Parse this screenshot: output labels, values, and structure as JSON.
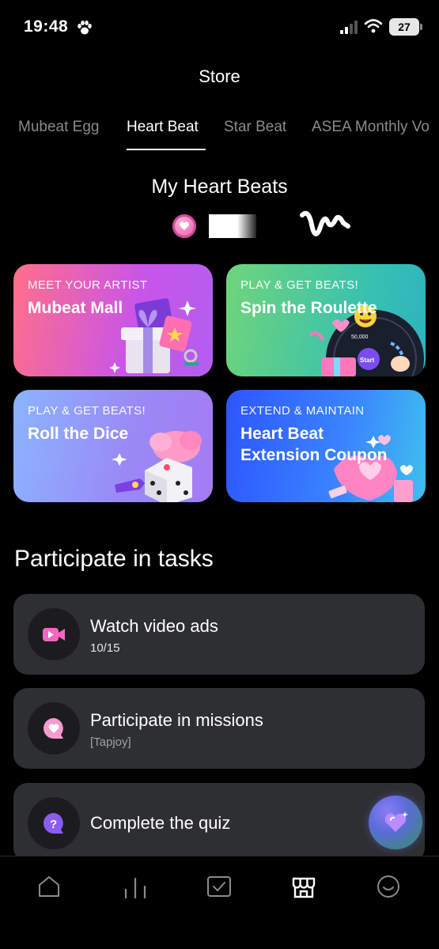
{
  "status_bar": {
    "time": "19:48",
    "battery": "27",
    "icons": [
      "paw-icon",
      "cellular-signal-icon",
      "wifi-icon",
      "battery-icon"
    ]
  },
  "header": {
    "title": "Store"
  },
  "tabs": [
    {
      "label": "Mubeat Egg",
      "active": false
    },
    {
      "label": "Heart Beat",
      "active": true
    },
    {
      "label": "Star Beat",
      "active": false
    },
    {
      "label": "ASEA Monthly Vo",
      "active": false
    }
  ],
  "my_heart_beats": {
    "title": "My Heart Beats"
  },
  "cards": [
    {
      "kicker": "MEET YOUR ARTIST",
      "title": "Mubeat Mall"
    },
    {
      "kicker": "PLAY & GET BEATS!",
      "title": "Spin the Roulette",
      "art_text_1": "50,000",
      "art_text_2": "Start"
    },
    {
      "kicker": "PLAY & GET BEATS!",
      "title": "Roll the Dice"
    },
    {
      "kicker": "EXTEND & MAINTAIN",
      "title_line1": "Heart Beat",
      "title_line2": "Extension Coupon"
    }
  ],
  "tasks": {
    "title": "Participate in tasks",
    "items": [
      {
        "name": "Watch video ads",
        "sub": "10/15",
        "icon": "video-camera-icon"
      },
      {
        "name": "Participate in missions",
        "sub": "[Tapjoy]",
        "icon": "heart-chat-icon"
      },
      {
        "name": "Complete the quiz",
        "icon": "question-chat-icon"
      }
    ]
  },
  "bottom_nav": {
    "items": [
      "home-icon",
      "charts-icon",
      "vote-check-icon",
      "store-icon",
      "profile-icon"
    ],
    "active": "store-icon"
  },
  "colors": {
    "background": "#000000",
    "task_card": "#2e2f33",
    "accent_pink": "#f06ab2",
    "inactive_tab": "#8a8a8a"
  }
}
